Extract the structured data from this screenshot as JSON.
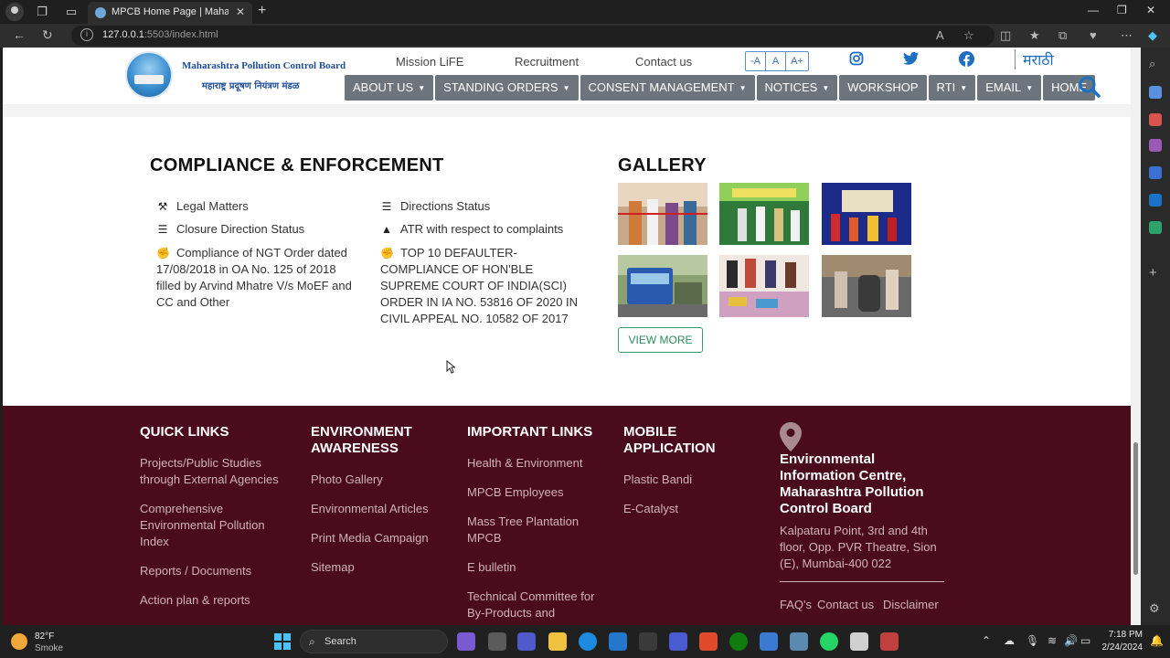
{
  "browser": {
    "tab_title": "MPCB Home Page | Maharashtra Pollution Control Board",
    "url_host": "127.0.0.1",
    "url_rest": ":5503/index.html"
  },
  "header": {
    "org_english": "Maharashtra Pollution Control Board",
    "org_marathi": "महाराष्ट्र प्रदूषण नियंत्रण मंडळ",
    "top_links": [
      "Mission LiFE",
      "Recruitment",
      "Contact us"
    ],
    "font_sizes": [
      "-A",
      "A",
      "A+"
    ],
    "language": "मराठी",
    "menu": [
      {
        "label": "ABOUT US",
        "dropdown": true
      },
      {
        "label": "STANDING ORDERS",
        "dropdown": true
      },
      {
        "label": "CONSENT MANAGEMENT",
        "dropdown": true
      },
      {
        "label": "NOTICES",
        "dropdown": true
      },
      {
        "label": "WORKSHOP",
        "dropdown": false
      },
      {
        "label": "RTI",
        "dropdown": true
      },
      {
        "label": "EMAIL",
        "dropdown": true
      },
      {
        "label": "HOME",
        "dropdown": false
      }
    ]
  },
  "compliance": {
    "title": "COMPLIANCE & ENFORCEMENT",
    "items": [
      {
        "icon": "gavel-icon",
        "text": "Legal Matters"
      },
      {
        "icon": "list-icon",
        "text": "Directions Status"
      },
      {
        "icon": "list-icon",
        "text": "Closure Direction Status"
      },
      {
        "icon": "warning-icon",
        "text": "ATR with respect to complaints"
      },
      {
        "icon": "handshake-icon",
        "text": "Compliance of NGT Order dated 17/08/2018 in OA No. 125 of 2018 filled by Arvind Mhatre V/s MoEF and CC and Other"
      },
      {
        "icon": "handshake-icon",
        "text": "TOP 10 DEFAULTER-COMPLIANCE OF HON'BLE SUPREME COURT OF INDIA(SCI) ORDER IN IA NO. 53816 OF 2020 IN CIVIL APPEAL NO. 10582 OF 2017"
      }
    ]
  },
  "gallery": {
    "title": "GALLERY",
    "view_more": "VIEW MORE"
  },
  "footer": {
    "quick_links": {
      "title": "QUICK LINKS",
      "items": [
        "Projects/Public Studies through External Agencies",
        "Comprehensive Environmental Pollution Index",
        "Reports / Documents",
        "Action plan & reports"
      ]
    },
    "environment_awareness": {
      "title": "ENVIRONMENT AWARENESS",
      "items": [
        "Photo Gallery",
        "Environmental Articles",
        "Print Media Campaign",
        "Sitemap"
      ]
    },
    "important_links": {
      "title": "IMPORTANT LINKS",
      "items": [
        "Health & Environment",
        "MPCB Employees",
        "Mass Tree Plantation MPCB",
        "E bulletin",
        "Technical Committee for By-Products and"
      ]
    },
    "mobile_application": {
      "title": "MOBILE APPLICATION",
      "items": [
        "Plastic Bandi",
        "E-Catalyst"
      ]
    },
    "address": {
      "title": "Environmental Information Centre, Maharashtra Pollution Control Board",
      "text": "Kalpataru Point, 3rd and 4th floor, Opp. PVR Theatre, Sion (E), Mumbai-400 022"
    },
    "bottom_links": [
      "FAQ's",
      "Contact us",
      "Disclaimer"
    ]
  },
  "taskbar": {
    "temp": "82°F",
    "condition": "Smoke",
    "search_label": "Search",
    "time": "7:18 PM",
    "date": "2/24/2024"
  }
}
